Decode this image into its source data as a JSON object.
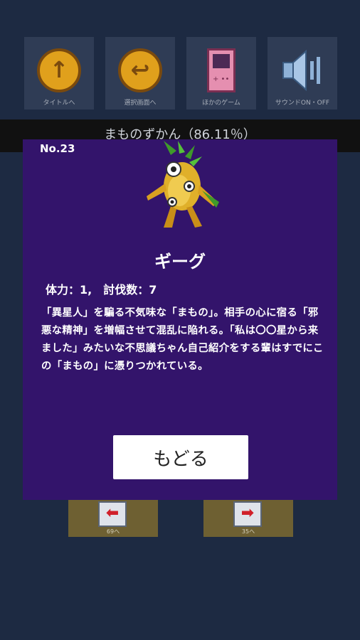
{
  "top_buttons": [
    {
      "label": "タイトルへ",
      "icon": "up-arrow-coin-icon",
      "glyph": "↑"
    },
    {
      "label": "選択画面へ",
      "icon": "back-arrow-coin-icon",
      "glyph": "↩"
    },
    {
      "label": "ほかのゲーム",
      "icon": "gameboy-icon"
    },
    {
      "label": "サウンドON・OFF",
      "icon": "speaker-icon"
    }
  ],
  "encyclopedia_title": "まものずかん（86.11％）",
  "monster": {
    "number": "No.23",
    "name": "ギーグ",
    "stats": "体力：1,　討伐数：7",
    "description": "「異星人」を騙る不気味な「まもの」。相手の心に宿る「邪悪な精神」を増幅させて混乱に陥れる。「私は〇〇星から来ました」みたいな不思議ちゃん自己紹介をする輩はすでにこの「まもの」に憑りつかれている。"
  },
  "back_button": "もどる",
  "page_buttons": {
    "prev": {
      "arrow": "⬅",
      "label": "69へ"
    },
    "next": {
      "arrow": "➡",
      "label": "35へ"
    }
  },
  "colors": {
    "background": "#1d2a42",
    "modal": "#33146b",
    "top_button": "#2f3c55"
  }
}
